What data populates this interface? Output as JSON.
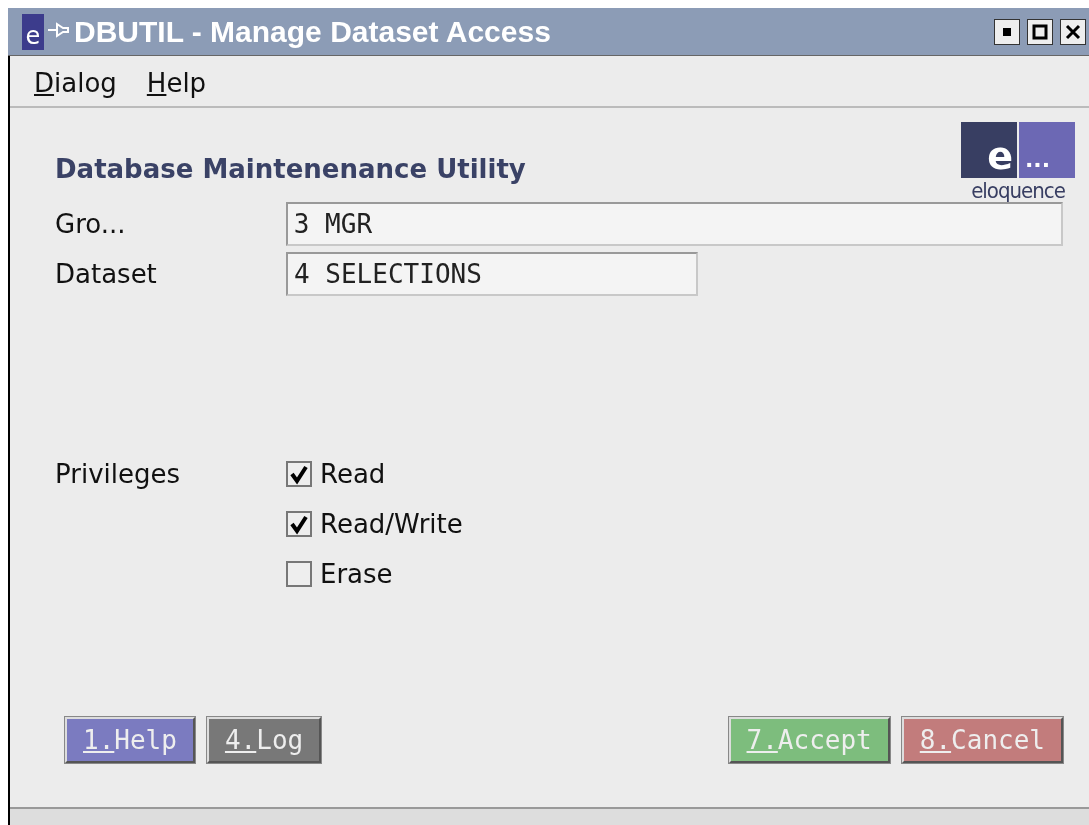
{
  "window": {
    "title": "DBUTIL - Manage Dataset Access",
    "icon_text": "e"
  },
  "menu": [
    {
      "label": "Dialog"
    },
    {
      "label": "Help"
    }
  ],
  "heading": "Database Maintenenance Utility",
  "logo": {
    "letter": "e",
    "dots": "...",
    "wordmark": "eloquence"
  },
  "fields": [
    {
      "label": "Gro...",
      "value": "3 MGR"
    },
    {
      "label": "Dataset",
      "value": "4 SELECTIONS"
    }
  ],
  "privileges": {
    "label": "Privileges",
    "options": [
      {
        "label": "Read",
        "checked": true
      },
      {
        "label": "Read/Write",
        "checked": true
      },
      {
        "label": "Erase",
        "checked": false
      }
    ]
  },
  "left_buttons": [
    {
      "label": "1.Help",
      "color": "#7b7bc0"
    },
    {
      "label": "4.Log",
      "color": "#787878"
    }
  ],
  "right_buttons": [
    {
      "label": "7.Accept",
      "color": "#7dbd7d"
    },
    {
      "label": "8.Cancel",
      "color": "#c27c7c"
    }
  ]
}
